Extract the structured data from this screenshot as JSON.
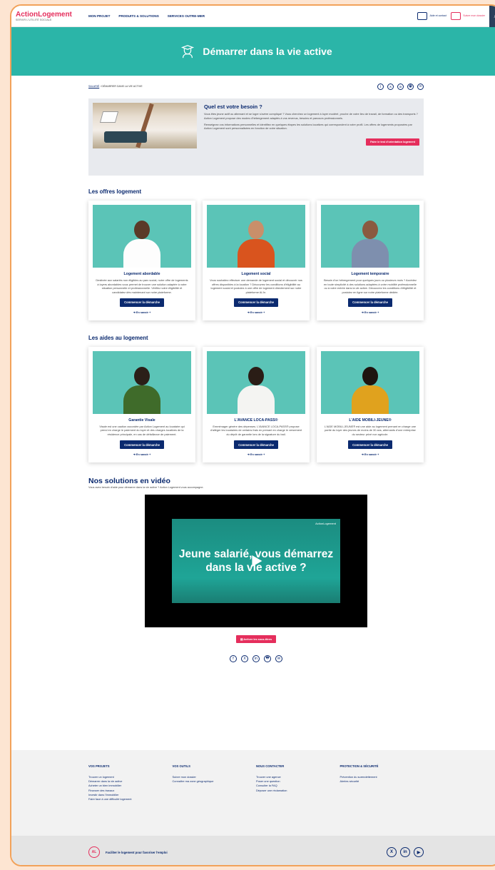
{
  "header": {
    "logo": "ActionLogement",
    "logo_sub": "SERVIR L'UTILITÉ SOCIALE",
    "nav": [
      "MON PROJET",
      "PRODUITS & SOLUTIONS",
      "SERVICES OUTRE-MER"
    ],
    "help_label": "Aide et contact",
    "file_label": "Suivre mon dossier"
  },
  "hero": {
    "title": "Démarrer dans la vie active"
  },
  "breadcrumb": {
    "home": "SALARIÉ",
    "sep": "›",
    "current": "DÉMARRER DANS LA VIE ACTIVE"
  },
  "share_icons": [
    "f",
    "X",
    "in",
    "🖶",
    "✉"
  ],
  "need": {
    "title": "Quel est votre besoin ?",
    "p1": "Vous êtes jeune actif ou alternant et se loger s'avère compliqué ? Vous cherchez un logement à loyer modéré, proche de votre lieu de travail, de formation ou des transports ? Action Logement propose des modes d'hébergement adaptés à vos revenus, besoins et parcours professionnels.",
    "p2": "Renseignez vos informations personnelles et identifiez en quelques étapes les solutions locatives qui correspondent à votre profil. Les offres de logements proposées par Action Logement sont personnalisées en fonction de votre situation.",
    "button": "Faire le test d'orientation logement"
  },
  "offers": {
    "title": "Les offres logement",
    "cards": [
      {
        "title": "Logement abordable",
        "text": "Destinée aux salariés non éligibles au parc social, notre offre de logements à loyers abordables vous permet de trouver une solution adaptée à votre situation personnelle et professionnelle. Vérifiez votre éligibilité et candidatez dès maintenant sur notre plateforme.",
        "button": "Commencer la démarche",
        "more": "➜ En savoir +"
      },
      {
        "title": "Logement social",
        "text": "Vous souhaitez effectuer une demande de logement social et découvrir nos offres disponibles à la location ? Découvrez les conditions d'éligibilité au logement social et postulez à une offre de logement directement sur notre plateforme AL'in.",
        "button": "Commencer la démarche",
        "more": "➜ En savoir +"
      },
      {
        "title": "Logement temporaire",
        "text": "Besoin d'un hébergement pour quelques jours ou plusieurs mois ? Accédez en toute simplicité à des solutions adaptées à votre mobilité professionnelle ou à votre entrée dans la vie active. Découvrez les conditions d'éligibilité et postulez en ligne sur notre plateforme dédiée.",
        "button": "Commencer la démarche",
        "more": "➜ En savoir +"
      }
    ]
  },
  "aids": {
    "title": "Les aides au logement",
    "cards": [
      {
        "title": "Garantie Visale",
        "text": "Visale est une caution accordée par Action Logement au locataire qui prend en charge le paiement du loyer et des charges locatives de la résidence principale, en cas de défaillance de paiement.",
        "button": "Commencer la démarche",
        "more": "➜ En savoir +"
      },
      {
        "title": "L'AVANCE LOCA-PASS®",
        "text": "Emménager génère des dépenses. L'AVANCE LOCA-PASS® propose d'alléger les locataires de certains frais en prenant en charge le versement du dépôt de garantie lors de la signature du bail.",
        "button": "Commencer la démarche",
        "more": "➜ En savoir +"
      },
      {
        "title": "L'AIDE MOBILI-JEUNE®",
        "text": "L'AIDE MOBILI-JEUNE® est une aide au logement prenant en charge une partie du loyer des jeunes de moins de 30 ans, alternants d'une entreprise du secteur privé non agricole.",
        "button": "Commencer la démarche",
        "more": "➜ En savoir +"
      }
    ]
  },
  "video": {
    "title": "Nos solutions en vidéo",
    "subtitle": "Vous avez besoin d'aide pour démarrer dans la vie active ? Action Logement vous accompagne.",
    "text": "Jeune salarié, vous démarrez dans la vie active ?",
    "logo": "ActionLogement",
    "subtitles_button": "▤ Activer les sous-titres"
  },
  "footer": {
    "cols": [
      {
        "title": "VOS PROJETS",
        "items": [
          "Trouver un logement",
          "Démarrer dans la vie active",
          "Acheter un bien immobilier",
          "Financer des travaux",
          "Investir dans l'immobilier",
          "Faire face à une difficulté logement"
        ]
      },
      {
        "title": "VOS OUTILS",
        "items": [
          "Suivre mon dossier",
          "Connaître ma zone géographique"
        ]
      },
      {
        "title": "NOUS CONTACTER",
        "items": [
          "Trouver une agence",
          "Poser une question",
          "Consulter la FAQ",
          "Déposer une réclamation"
        ]
      },
      {
        "title": "PROTECTION & SÉCURITÉ",
        "items": [
          "Prévention du surendettement",
          "Alertes sécurité"
        ]
      }
    ],
    "logo": "AL",
    "tagline": "Faciliter le logement pour favoriser l'emploi",
    "social": [
      "X",
      "in",
      "▶"
    ]
  },
  "colors": {
    "teal": "#2bb5a8",
    "navy": "#0b2a6f",
    "red": "#e52e5c"
  }
}
